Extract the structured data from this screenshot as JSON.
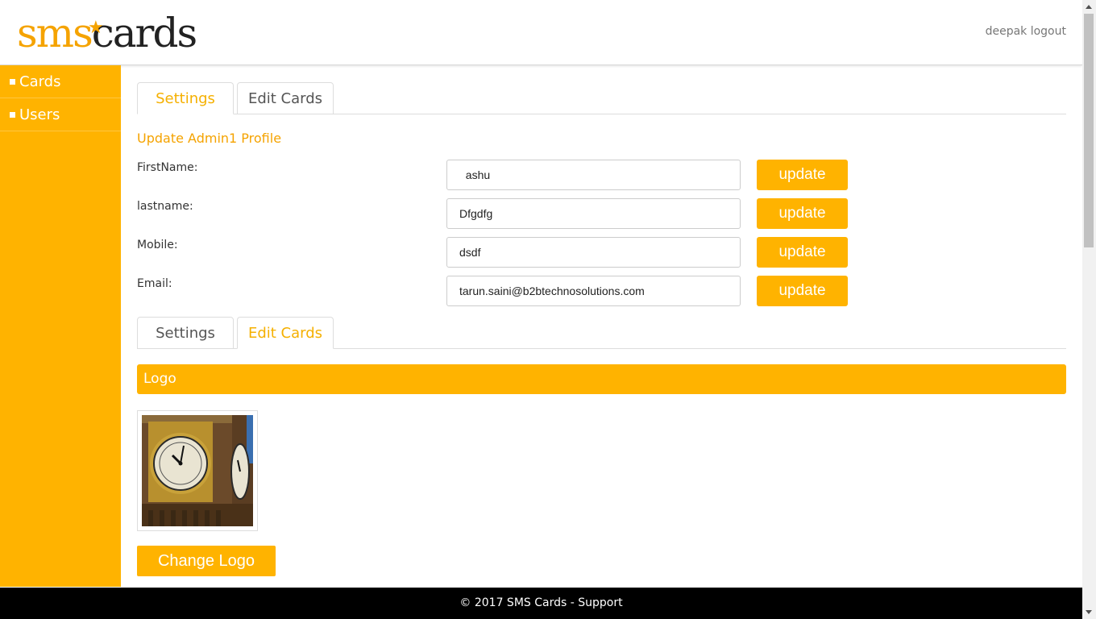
{
  "header": {
    "logo_sms": "sms",
    "logo_cards": "cards",
    "username": "deepak",
    "logout": "logout"
  },
  "sidebar": {
    "items": [
      {
        "label": "Cards"
      },
      {
        "label": "Users"
      }
    ]
  },
  "tabs_top": [
    {
      "label": "Settings",
      "active": true
    },
    {
      "label": "Edit Cards",
      "active": false
    }
  ],
  "profile": {
    "title": "Update Admin1 Profile",
    "fields": [
      {
        "label": "FirstName:",
        "value": "  ashu",
        "button": "update"
      },
      {
        "label": "lastname:",
        "value": "Dfgdfg",
        "button": "update"
      },
      {
        "label": "Mobile:",
        "value": "dsdf",
        "button": "update"
      },
      {
        "label": "Email:",
        "value": "tarun.saini@b2btechnosolutions.com",
        "button": "update"
      }
    ]
  },
  "tabs_bottom": [
    {
      "label": "Settings",
      "active": false
    },
    {
      "label": "Edit Cards",
      "active": true
    }
  ],
  "logo_section": {
    "title": "Logo",
    "change_button": "Change Logo"
  },
  "footer": {
    "text": "© 2017 SMS Cards - Support"
  },
  "colors": {
    "accent": "#ffb300",
    "footer_bg": "#000000"
  }
}
